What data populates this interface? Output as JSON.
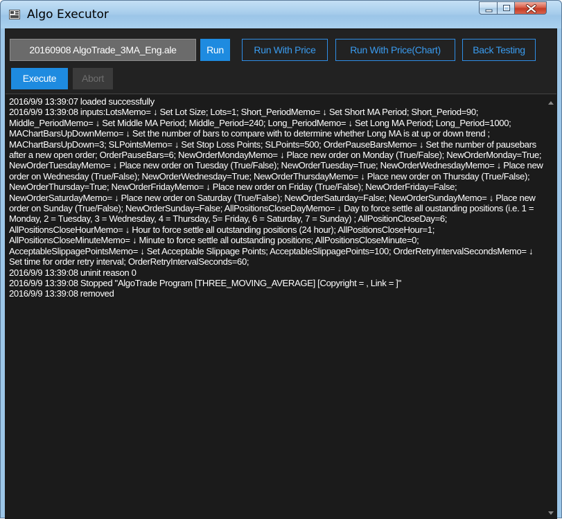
{
  "window": {
    "title": "Algo Executor",
    "icons": {
      "app": "algo-executor-app-icon",
      "minimize": "minimize-icon",
      "maximize": "maximize-icon",
      "close": "close-icon"
    }
  },
  "toolbar": {
    "file_name": "20160908 AlgoTrade_3MA_Eng.ale",
    "run": "Run",
    "run_with_price": "Run With Price",
    "run_with_price_chart": "Run With Price(Chart)",
    "back_testing": "Back Testing",
    "execute": "Execute",
    "abort": "Abort"
  },
  "log": {
    "lines": [
      "2016/9/9 13:39:07 loaded successfully",
      "2016/9/9 13:39:08 inputs:LotsMemo= ↓ Set Lot Size; Lots=1; Short_PeriodMemo= ↓ Set Short MA Period; Short_Period=90; Middle_PeriodMemo= ↓ Set Middle MA Period; Middle_Period=240; Long_PeriodMemo= ↓ Set Long MA Period; Long_Period=1000; MAChartBarsUpDownMemo= ↓ Set the number of bars to compare with to determine whether Long MA is at up or down trend ; MAChartBarsUpDown=3; SLPointsMemo= ↓ Set Stop Loss Points; SLPoints=500; OrderPauseBarsMemo= ↓ Set the number of pausebars after a new open order; OrderPauseBars=6; NewOrderMondayMemo= ↓ Place new order on Monday (True/False); NewOrderMonday=True; NewOrderTuesdayMemo= ↓ Place new order on Tuesday (True/False); NewOrderTuesday=True; NewOrderWednesdayMemo= ↓ Place new order on Wednesday (True/False); NewOrderWednesday=True; NewOrderThursdayMemo= ↓ Place new order on Thursday (True/False); NewOrderThursday=True; NewOrderFridayMemo= ↓ Place new order on Friday (True/False); NewOrderFriday=False; NewOrderSaturdayMemo= ↓ Place new order on Saturday (True/False); NewOrderSaturday=False; NewOrderSundayMemo= ↓ Place new order on Sunday (True/False); NewOrderSunday=False; AllPositionsCloseDayMemo= ↓ Day to force settle all oustanding positions (i.e. 1 = Monday, 2 = Tuesday, 3 = Wednesday, 4 = Thursday, 5= Friday, 6 = Saturday, 7 = Sunday) ; AllPositionCloseDay=6; AllPositionsCloseHourMemo= ↓ Hour to force settle all outstanding positions (24 hour); AllPositionsCloseHour=1; AllPositionsCloseMinuteMemo= ↓ Minute to force settle all outstanding positions; AllPositionsCloseMinute=0; AcceptableSlippagePointsMemo= ↓ Set Acceptable Slippage Points; AcceptableSlippagePoints=100; OrderRetryIntervalSecondsMemo= ↓ Set time for order retry interval; OrderRetryIntervalSeconds=60;",
      "2016/9/9 13:39:08 uninit reason 0",
      "2016/9/9 13:39:08 Stopped \"AlgoTrade Program [THREE_MOVING_AVERAGE] [Copyright = , Link = ]\"",
      "2016/9/9 13:39:08 removed"
    ]
  },
  "colors": {
    "accent": "#1e8be0",
    "background": "#222222",
    "log_background": "#1b1b1b",
    "text": "#ffffff",
    "titlebar": "#a7cdec"
  }
}
